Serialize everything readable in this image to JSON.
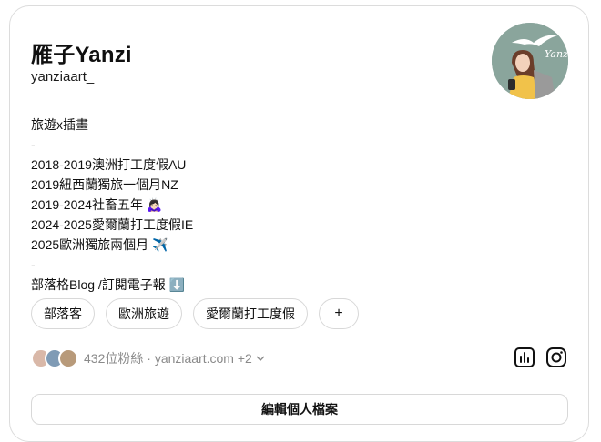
{
  "profile": {
    "display_name": "雁子Yanzi",
    "username": "yanziaart_",
    "avatar_text": "Yanzi"
  },
  "bio": [
    "旅遊x插畫",
    "-",
    "2018-2019澳洲打工度假AU",
    "2019紐西蘭獨旅一個月NZ",
    "2019-2024社畜五年 🙇🏻‍♀️",
    "2024-2025愛爾蘭打工度假IE",
    "2025歐洲獨旅兩個月 ✈️",
    "-",
    "部落格Blog /訂閱電子報 ⬇️"
  ],
  "tags": [
    "部落客",
    "歐洲旅遊",
    "愛爾蘭打工度假",
    "+"
  ],
  "followers": {
    "count_text": "432位粉絲",
    "separator": "·",
    "link_text": "yanziaart.com",
    "more_text": "+2"
  },
  "icons": {
    "insights": "bar-chart-icon",
    "instagram": "instagram-icon",
    "chevron": "chevron-down-icon"
  },
  "buttons": {
    "edit_profile": "編輯個人檔案"
  },
  "colors": {
    "avatar_bg": "#8aa59c",
    "muted_text": "#8a8a8a",
    "border": "#d8d8d8"
  }
}
